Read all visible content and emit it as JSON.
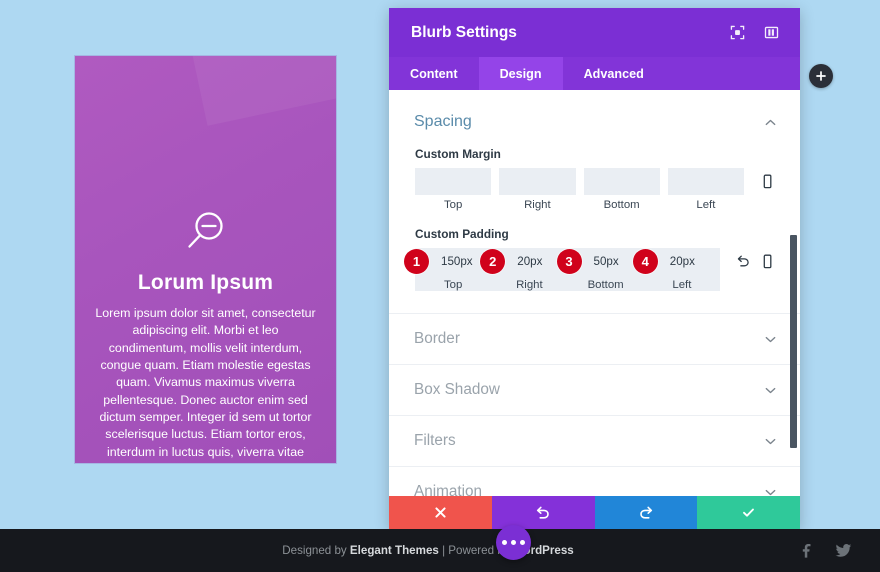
{
  "page": {
    "background_color": "#aed8f2"
  },
  "blurb": {
    "icon": "magnifier-minus-icon",
    "title": "Lorum Ipsum",
    "body": "Lorem ipsum dolor sit amet, consectetur adipiscing elit. Morbi et leo condimentum, mollis velit interdum, congue quam. Etiam molestie egestas quam. Vivamus maximus viverra pellentesque. Donec auctor enim sed dictum semper. Integer id sem ut tortor scelerisque luctus. Etiam tortor eros, interdum in luctus quis, viverra vitae tellus",
    "background_color": "#a855bd",
    "text_color": "#ffffff"
  },
  "modal": {
    "title": "Blurb Settings",
    "header_color": "#7b2fd4",
    "header_icons": [
      {
        "name": "focus-target-icon"
      },
      {
        "name": "layout-panel-icon"
      }
    ],
    "tabs": [
      {
        "label": "Content",
        "active": false
      },
      {
        "label": "Design",
        "active": true
      },
      {
        "label": "Advanced",
        "active": false
      }
    ],
    "section": {
      "title": "Spacing",
      "expanded": true,
      "collapse_icon": "chevron-up-icon"
    },
    "custom_margin": {
      "label": "Custom Margin",
      "fields": [
        {
          "caption": "Top",
          "value": "",
          "placeholder": ""
        },
        {
          "caption": "Right",
          "value": "",
          "placeholder": ""
        },
        {
          "caption": "Bottom",
          "value": "",
          "placeholder": ""
        },
        {
          "caption": "Left",
          "value": "",
          "placeholder": ""
        }
      ],
      "tools": [
        {
          "name": "responsive-mobile-icon"
        }
      ]
    },
    "custom_padding": {
      "label": "Custom Padding",
      "fields": [
        {
          "badge": "1",
          "caption": "Top",
          "value": "150px"
        },
        {
          "badge": "2",
          "caption": "Right",
          "value": "20px"
        },
        {
          "badge": "3",
          "caption": "Bottom",
          "value": "50px"
        },
        {
          "badge": "4",
          "caption": "Left",
          "value": "20px"
        }
      ],
      "tools": [
        {
          "name": "reset-undo-icon"
        },
        {
          "name": "responsive-mobile-icon"
        }
      ],
      "badge_color": "#d0021b"
    },
    "accordions": [
      {
        "label": "Border",
        "icon": "chevron-down-icon"
      },
      {
        "label": "Box Shadow",
        "icon": "chevron-down-icon"
      },
      {
        "label": "Filters",
        "icon": "chevron-down-icon"
      },
      {
        "label": "Animation",
        "icon": "chevron-down-icon"
      }
    ],
    "actions": [
      {
        "name": "cancel",
        "icon": "close-x-icon",
        "color": "#f0544c"
      },
      {
        "name": "undo",
        "icon": "undo-arrow-icon",
        "color": "#8431d9"
      },
      {
        "name": "redo",
        "icon": "redo-arrow-icon",
        "color": "#2186d8"
      },
      {
        "name": "save",
        "icon": "check-icon",
        "color": "#2fc99a"
      }
    ]
  },
  "add_button": {
    "icon": "plus-icon"
  },
  "fab": {
    "icon": "ellipsis-icon"
  },
  "footer": {
    "prefix": "Designed by ",
    "brand1": "Elegant Themes",
    "middle": " | Powered by ",
    "brand2": "WordPress",
    "social": [
      {
        "name": "facebook-icon"
      },
      {
        "name": "twitter-icon"
      }
    ]
  }
}
